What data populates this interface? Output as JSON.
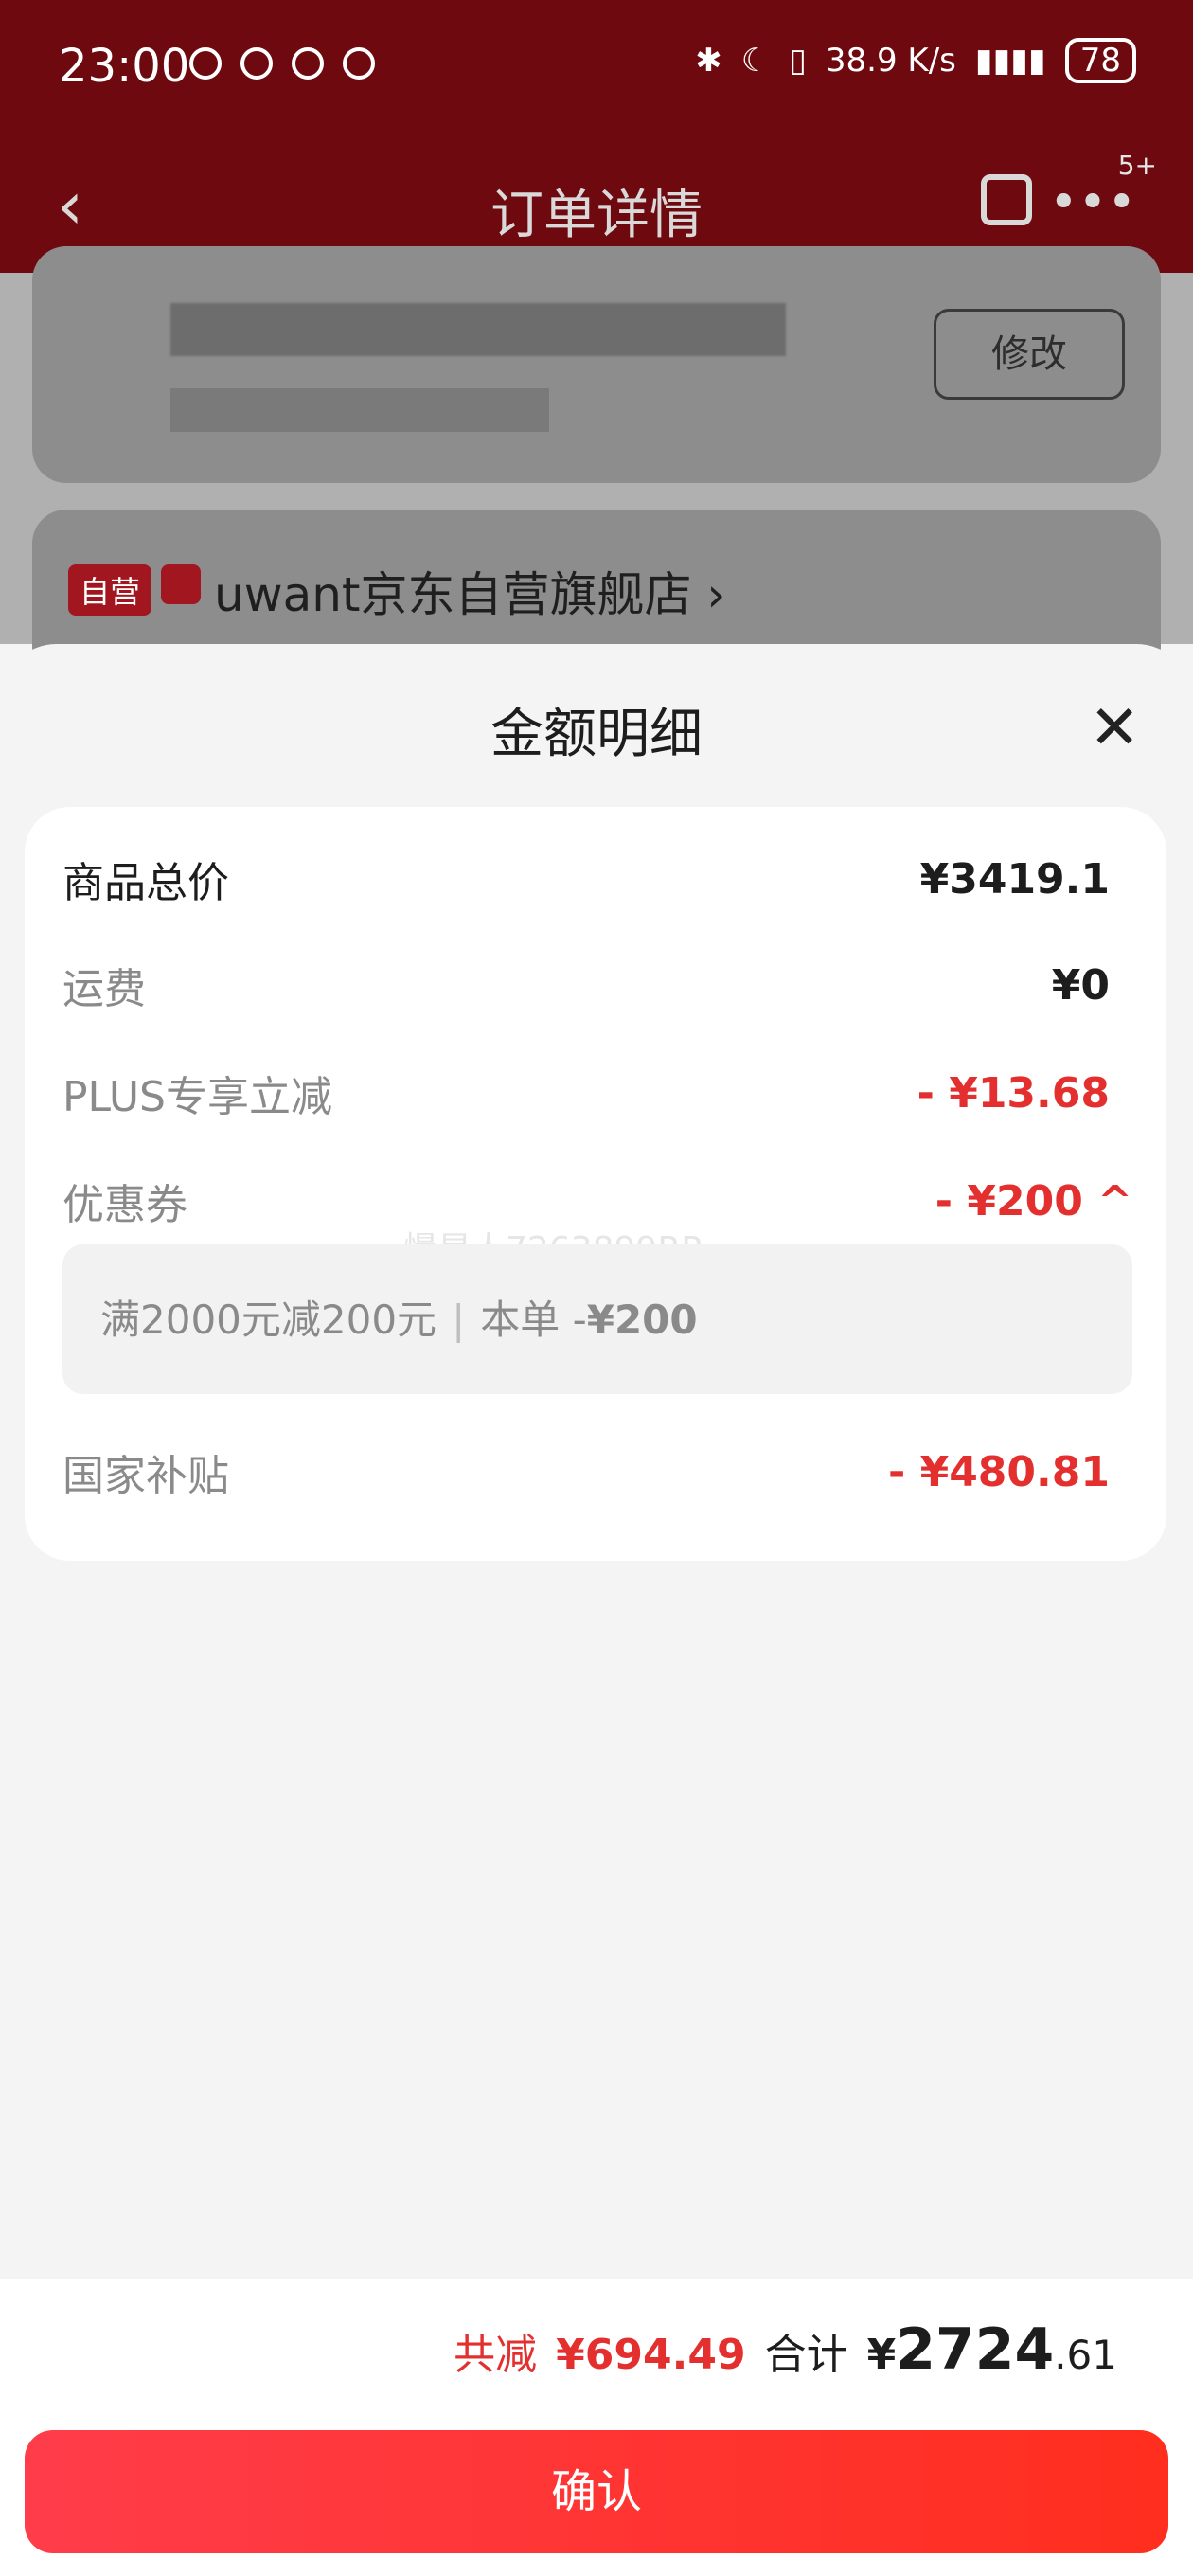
{
  "status_bar": {
    "time": "23:00",
    "net_speed": "38.9 K/s",
    "battery": "78"
  },
  "nav": {
    "back_icon": "chevron-left-icon",
    "title": "订单详情",
    "share_icon": "share-icon",
    "more_icon": "more-icon",
    "badge": "5+"
  },
  "background": {
    "edit_label": "修改",
    "store_tag": "自营",
    "store_name": "uwant京东自营旗舰店 ›"
  },
  "sheet": {
    "title": "金额明细",
    "rows": [
      {
        "label": "商品总价",
        "value": "¥3419.1"
      },
      {
        "label": "运费",
        "value": "¥0"
      },
      {
        "label": "PLUS专享立减",
        "value": "- ¥13.68"
      },
      {
        "label": "优惠券",
        "value": "- ¥200 ^"
      },
      {
        "label": "国家补贴",
        "value": "- ¥480.81"
      }
    ],
    "coupon": {
      "condition": "满2000元减200元",
      "scope_label": "本单 -",
      "amount": "¥200"
    },
    "watermark": "慢星人7263899RP"
  },
  "footer": {
    "total_discount_label": "共减",
    "total_discount_value": "¥694.49",
    "total_label": "合计",
    "total_currency": "¥",
    "total_int": "2724",
    "total_decimals": ".61",
    "confirm_label": "确认"
  },
  "colors": {
    "header_red": "#6e0a0f",
    "accent_red": "#e3302f",
    "button_gradient_start": "#ff3c4a",
    "button_gradient_end": "#ff2e1e"
  }
}
